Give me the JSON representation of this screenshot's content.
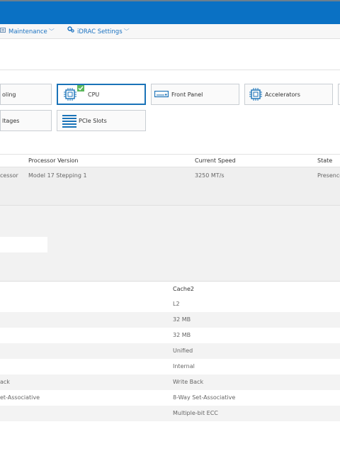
{
  "menu": {
    "maintenance": "Maintenance",
    "idrac_settings": "iDRAC Settings",
    "chevron": "﹀"
  },
  "tiles": {
    "cooling": "oling",
    "cpu": "CPU",
    "front_panel": "Front Panel",
    "accelerators": "Accelerators",
    "voltages": "ltages",
    "pcie_slots": "PCIe Slots"
  },
  "processor_table": {
    "headers": {
      "version": "Processor Version",
      "speed": "Current Speed",
      "state": "State"
    },
    "row": {
      "name": "cessor",
      "version": "Model 17 Stepping 1",
      "speed": "3250 MT/s",
      "state": "Presence"
    }
  },
  "cache_table": {
    "header": {
      "cache2": "Cache2"
    },
    "rows": [
      {
        "left": "",
        "cache2": "L2"
      },
      {
        "left": "",
        "cache2": "32 MB"
      },
      {
        "left": "",
        "cache2": "32 MB"
      },
      {
        "left": "",
        "cache2": "Unified"
      },
      {
        "left": "",
        "cache2": "Internal"
      },
      {
        "left": "ack",
        "cache2": "Write Back"
      },
      {
        "left": "et-Associative",
        "cache2": "8-Way Set-Associative"
      },
      {
        "left": "",
        "cache2": "Multiple-bit ECC"
      },
      {
        "left": "",
        "cache2": ""
      }
    ]
  },
  "colors": {
    "topbar": "#0a71c4",
    "link": "#1b72c1",
    "selected_border": "#1a73b8",
    "check": "#5cb85c"
  }
}
